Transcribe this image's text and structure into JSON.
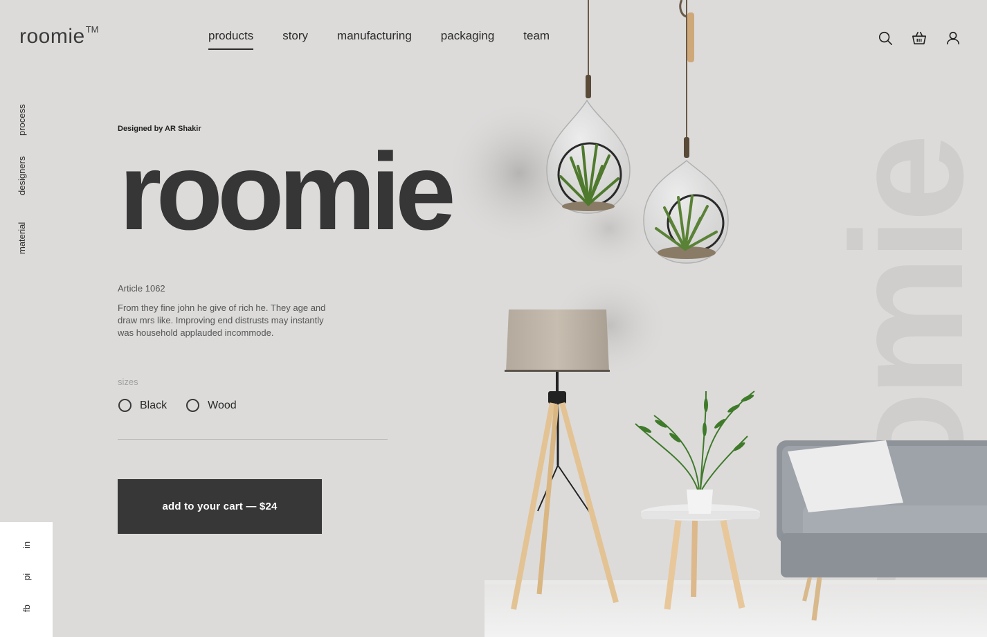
{
  "brand": {
    "name": "roomie",
    "trademark": "TM"
  },
  "nav": {
    "items": [
      {
        "label": "products",
        "active": true
      },
      {
        "label": "story",
        "active": false
      },
      {
        "label": "manufacturing",
        "active": false
      },
      {
        "label": "packaging",
        "active": false
      },
      {
        "label": "team",
        "active": false
      }
    ]
  },
  "header_icons": [
    "search-icon",
    "basket-icon",
    "user-icon"
  ],
  "side_nav": {
    "items": [
      "process",
      "designers",
      "material"
    ]
  },
  "social": {
    "items": [
      "in",
      "pi",
      "fb"
    ]
  },
  "product": {
    "designer": "Designed by AR Shakir",
    "title": "roomie",
    "article": "Article 1062",
    "description": "From they fine john he give of rich he. They age and draw mrs like. Improving end distrusts may instantly was household applauded incommode.",
    "sizes_label": "sizes",
    "options": [
      "Black",
      "Wood"
    ],
    "cart_label": "add to your cart — $24"
  },
  "watermark": "roomie",
  "colors": {
    "background": "#dcdbda",
    "button": "#373737",
    "text_dark": "#363636"
  }
}
